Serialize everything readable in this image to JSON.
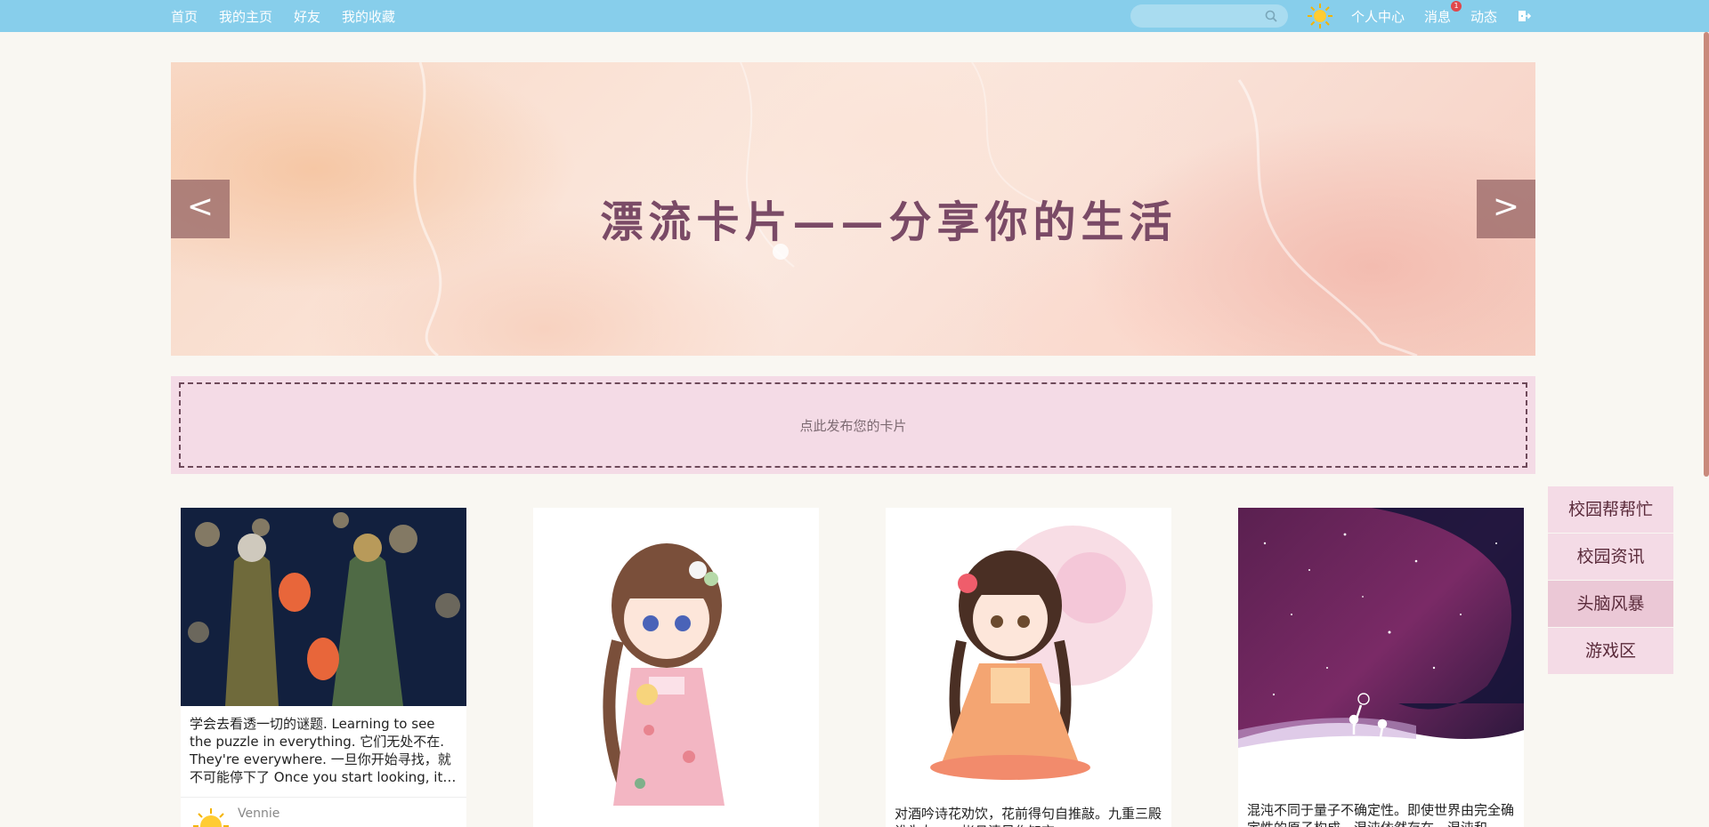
{
  "nav": {
    "home": "首页",
    "my_home": "我的主页",
    "friends": "好友",
    "favorites": "我的收藏",
    "personal_center": "个人中心",
    "messages": "消息",
    "message_badge": "1",
    "activity": "动态",
    "search_placeholder": ""
  },
  "banner": {
    "title": "漂流卡片——分享你的生活",
    "prev": "<",
    "next": ">"
  },
  "publish": {
    "prompt": "点此发布您的卡片"
  },
  "cards": [
    {
      "text": "学会去看透一切的谜题. Learning to see the puzzle in everything. 它们无处不在. They're everywhere. 一旦你开始寻找，就不可能停下了 Once you start looking, it's impossible to stop",
      "author": "Vennie"
    },
    {
      "text": ""
    },
    {
      "text": "对酒吟诗花劝饮，花前得句自推敲。九重三殿谁为友，一帐月清风作知交"
    },
    {
      "text": "混沌不同于量子不确定性。即使世界由完全确定性的原子构成，混沌依然存在。混沌和"
    }
  ],
  "side_menu": [
    "校园帮帮忙",
    "校园资讯",
    "头脑风暴",
    "游戏区"
  ],
  "colors": {
    "topbar": "#87ceeb",
    "publish_bg": "#f4dbe6",
    "banner_title": "#7a4a66"
  }
}
